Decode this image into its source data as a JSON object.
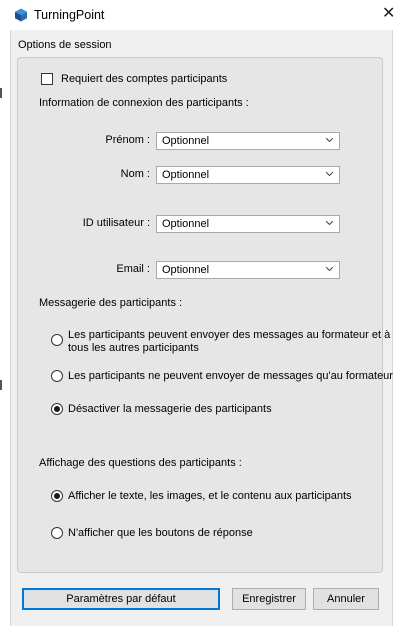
{
  "window": {
    "title": "TurningPoint",
    "close_glyph": "✕",
    "app_icon": "turningpoint-cube-icon"
  },
  "session_options": {
    "title": "Options de session",
    "require_accounts": {
      "label": "Requiert des comptes participants",
      "checked": false
    },
    "login_info_title": "Information de connexion des participants :",
    "fields": [
      {
        "label": "Prénom :",
        "value": "Optionnel"
      },
      {
        "label": "Nom :",
        "value": "Optionnel"
      },
      {
        "label": "ID utilisateur :",
        "value": "Optionnel"
      },
      {
        "label": "Email :",
        "value": "Optionnel"
      }
    ],
    "messaging_title": "Messagerie des participants :",
    "messaging_options": [
      {
        "label_line1": "Les participants peuvent envoyer des messages au formateur et à",
        "label_line2": "tous les autres participants",
        "selected": false
      },
      {
        "label": "Les participants ne peuvent envoyer de messages qu'au formateur",
        "selected": false
      },
      {
        "label": "Désactiver la messagerie des participants",
        "selected": true
      }
    ],
    "display_title": "Affichage des questions des participants :",
    "display_options": [
      {
        "label": "Afficher le texte, les images, et le contenu aux participants",
        "selected": true
      },
      {
        "label": "N'afficher que les boutons de réponse",
        "selected": false
      }
    ]
  },
  "buttons": {
    "defaults": "Paramètres par défaut",
    "save": "Enregistrer",
    "cancel": "Annuler"
  }
}
